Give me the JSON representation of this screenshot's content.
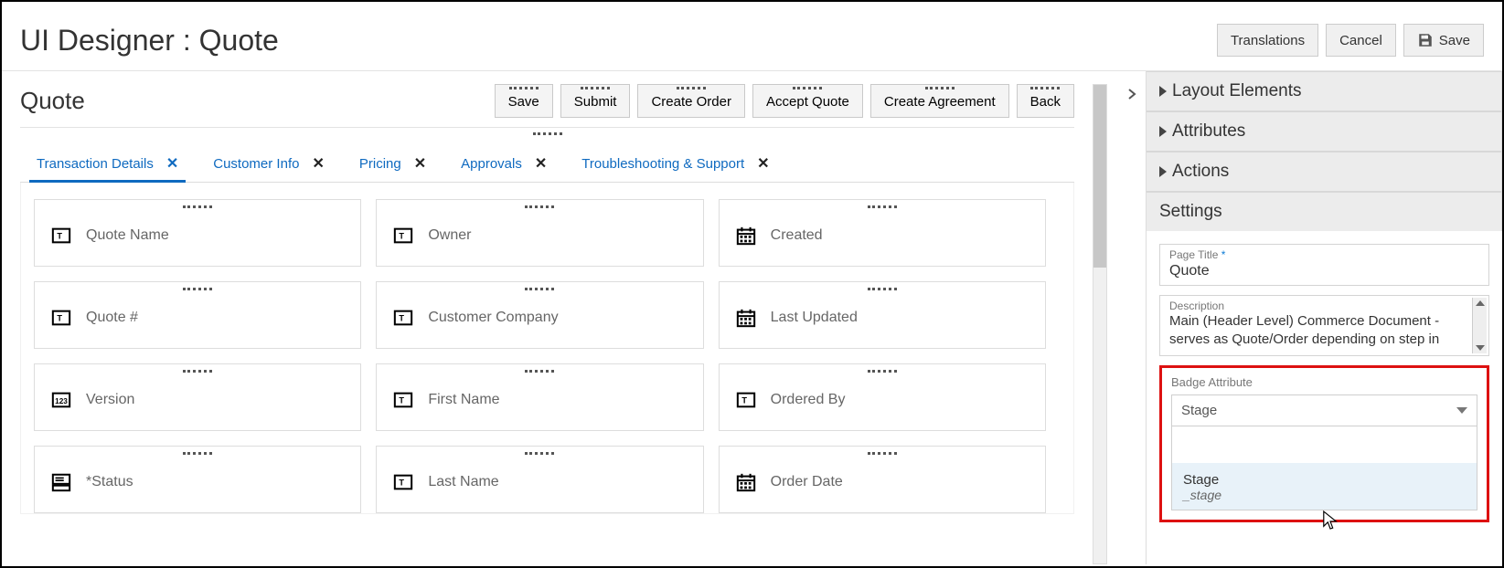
{
  "header": {
    "title": "UI Designer : Quote",
    "buttons": {
      "translations": "Translations",
      "cancel": "Cancel",
      "save": "Save"
    }
  },
  "canvas": {
    "title": "Quote",
    "actions": {
      "save": "Save",
      "submit": "Submit",
      "create_order": "Create Order",
      "accept_quote": "Accept Quote",
      "create_agreement": "Create Agreement",
      "back": "Back"
    },
    "tabs": [
      {
        "label": "Transaction Details",
        "active": true
      },
      {
        "label": "Customer Info",
        "active": false
      },
      {
        "label": "Pricing",
        "active": false
      },
      {
        "label": "Approvals",
        "active": false
      },
      {
        "label": "Troubleshooting & Support",
        "active": false
      }
    ],
    "fields": [
      {
        "icon": "text",
        "label": "Quote Name"
      },
      {
        "icon": "text",
        "label": "Owner"
      },
      {
        "icon": "date",
        "label": "Created"
      },
      {
        "icon": "text",
        "label": "Quote #"
      },
      {
        "icon": "text",
        "label": "Customer Company"
      },
      {
        "icon": "date",
        "label": "Last Updated"
      },
      {
        "icon": "number",
        "label": "Version"
      },
      {
        "icon": "text",
        "label": "First Name"
      },
      {
        "icon": "text",
        "label": "Ordered By"
      },
      {
        "icon": "menu",
        "label": "*Status"
      },
      {
        "icon": "text",
        "label": "Last Name"
      },
      {
        "icon": "date",
        "label": "Order Date"
      }
    ]
  },
  "panel": {
    "sections": {
      "layout_elements": "Layout Elements",
      "attributes": "Attributes",
      "actions": "Actions",
      "settings": "Settings"
    },
    "settings": {
      "page_title_label": "Page Title",
      "page_title_value": "Quote",
      "description_label": "Description",
      "description_value": "Main (Header Level) Commerce Document - serves as Quote/Order depending on  step in",
      "badge_attribute_label": "Badge Attribute",
      "badge_attribute_value": "Stage",
      "options": [
        {
          "label": "",
          "sub": ""
        },
        {
          "label": "Stage",
          "sub": "_stage"
        }
      ]
    }
  }
}
